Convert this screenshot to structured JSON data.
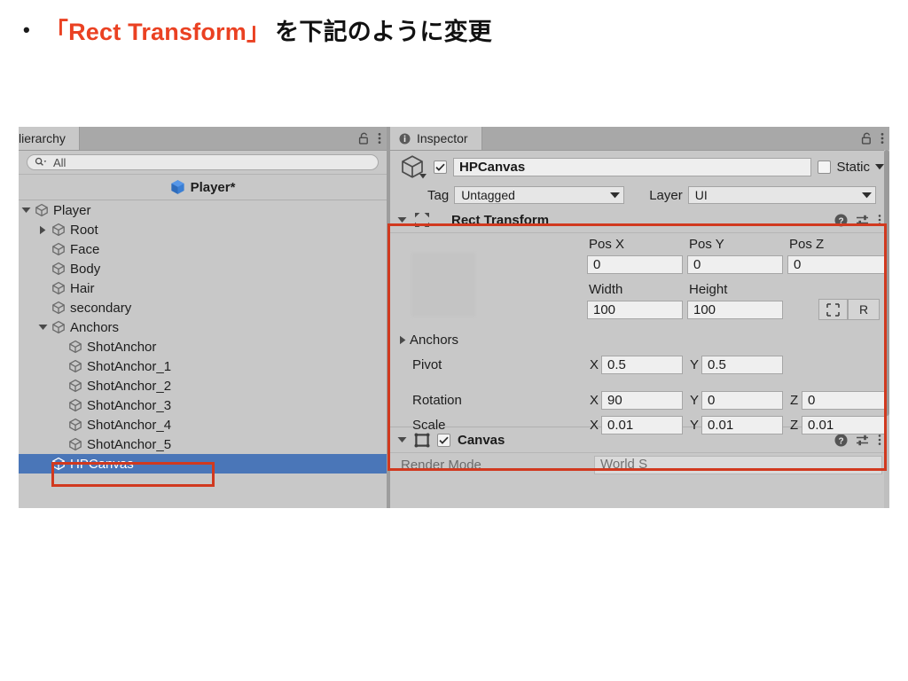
{
  "slide": {
    "bullet": "•",
    "accent_text": "「Rect Transform」",
    "plain_text": "を下記のように変更",
    "accent_color": "#ea4122"
  },
  "hierarchy": {
    "tab_label": "lierarchy",
    "tab_label_full": "Hierarchy",
    "lock_icon": "lock-open-icon",
    "menu_icon": "kebab-menu-icon",
    "search": {
      "icon": "search-icon",
      "value": "All",
      "placeholder": "All"
    },
    "prefab_breadcrumb": {
      "icon": "prefab-cube-icon",
      "label": "Player*"
    },
    "items": [
      {
        "label": "Player",
        "depth": 0,
        "twisty": "down",
        "selected": false
      },
      {
        "label": "Root",
        "depth": 1,
        "twisty": "right",
        "selected": false
      },
      {
        "label": "Face",
        "depth": 1,
        "twisty": "none",
        "selected": false
      },
      {
        "label": "Body",
        "depth": 1,
        "twisty": "none",
        "selected": false
      },
      {
        "label": "Hair",
        "depth": 1,
        "twisty": "none",
        "selected": false
      },
      {
        "label": "secondary",
        "depth": 1,
        "twisty": "none",
        "selected": false
      },
      {
        "label": "Anchors",
        "depth": 1,
        "twisty": "down",
        "selected": false
      },
      {
        "label": "ShotAnchor",
        "depth": 2,
        "twisty": "none",
        "selected": false
      },
      {
        "label": "ShotAnchor_1",
        "depth": 2,
        "twisty": "none",
        "selected": false
      },
      {
        "label": "ShotAnchor_2",
        "depth": 2,
        "twisty": "none",
        "selected": false
      },
      {
        "label": "ShotAnchor_3",
        "depth": 2,
        "twisty": "none",
        "selected": false
      },
      {
        "label": "ShotAnchor_4",
        "depth": 2,
        "twisty": "none",
        "selected": false
      },
      {
        "label": "ShotAnchor_5",
        "depth": 2,
        "twisty": "none",
        "selected": false
      },
      {
        "label": "HPCanvas",
        "depth": 1,
        "twisty": "none",
        "selected": true
      }
    ],
    "selection_color": "#4a76b8"
  },
  "inspector": {
    "tab_label": "Inspector",
    "tab_icon": "info-circle-icon",
    "lock_icon": "lock-open-icon",
    "menu_icon": "kebab-menu-icon",
    "object": {
      "icon": "prefab-cube-outline-icon",
      "enabled": true,
      "name": "HPCanvas",
      "static_label": "Static",
      "static_checked": false
    },
    "tag": {
      "label": "Tag",
      "value": "Untagged"
    },
    "layer": {
      "label": "Layer",
      "value": "UI"
    },
    "components": [
      {
        "title": "Rect Transform",
        "icon": "rect-transform-icon",
        "expanded": true,
        "help_icon": "help-circle-icon",
        "preset_icon": "preset-sliders-icon",
        "menu_icon": "kebab-menu-icon",
        "position": {
          "headers": [
            "Pos X",
            "Pos Y",
            "Pos Z"
          ],
          "values": [
            "0",
            "0",
            "0"
          ]
        },
        "size": {
          "headers": [
            "Width",
            "Height"
          ],
          "values": [
            "100",
            "100"
          ]
        },
        "blueprint_button": "blueprint-mode-icon",
        "rawedit_button": "R",
        "anchors_label": "Anchors",
        "anchors_expanded": false,
        "pivot": {
          "label": "Pivot",
          "axes": [
            "X",
            "Y"
          ],
          "values": [
            "0.5",
            "0.5"
          ]
        },
        "rotation": {
          "label": "Rotation",
          "axes": [
            "X",
            "Y",
            "Z"
          ],
          "values": [
            "90",
            "0",
            "0"
          ]
        },
        "scale": {
          "label": "Scale",
          "axes": [
            "X",
            "Y",
            "Z"
          ],
          "values": [
            "0.01",
            "0.01",
            "0.01"
          ]
        }
      },
      {
        "title": "Canvas",
        "icon": "canvas-icon",
        "expanded": true,
        "enabled": true,
        "help_icon": "help-circle-icon",
        "preset_icon": "preset-sliders-icon",
        "menu_icon": "kebab-menu-icon",
        "clipped_row": {
          "label": "Render Mode",
          "value": "World S"
        }
      }
    ]
  },
  "annotations": {
    "color": "#d1391f",
    "boxes": [
      "rect-transform-component",
      "hpcanvas-hierarchy-row"
    ]
  }
}
